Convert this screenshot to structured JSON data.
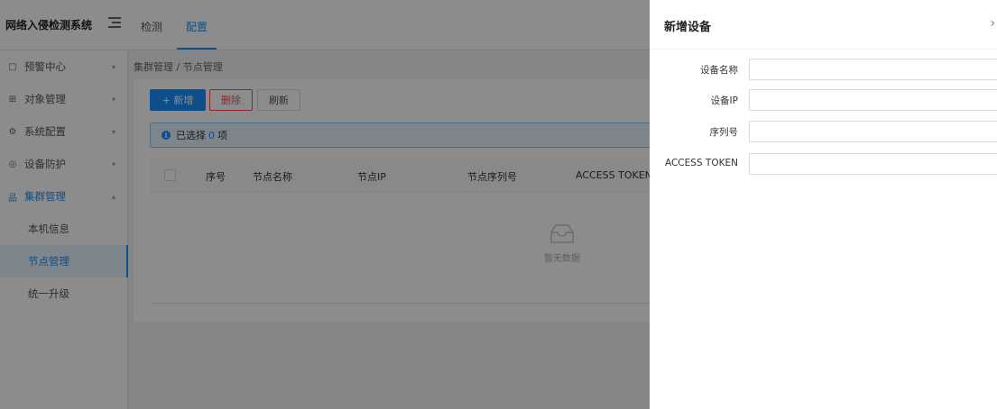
{
  "app": {
    "brand": "网络入侵检测系统",
    "top_tabs": [
      "检测",
      "配置"
    ]
  },
  "sidebar": {
    "items": [
      {
        "label": "预警中心",
        "icon": "bell-icon"
      },
      {
        "label": "对象管理",
        "icon": "grid-icon"
      },
      {
        "label": "系统配置",
        "icon": "gear-icon"
      },
      {
        "label": "设备防护",
        "icon": "shield-icon"
      },
      {
        "label": "集群管理",
        "icon": "cluster-icon"
      }
    ],
    "sub_items": [
      "本机信息",
      "节点管理",
      "统一升级"
    ]
  },
  "main": {
    "breadcrumb": "集群管理 / 节点管理",
    "buttons": {
      "add": "+ 新增",
      "delete": "删除",
      "refresh": "刷新"
    },
    "alert": {
      "prefix": "已选择",
      "count": "0",
      "suffix": "项"
    },
    "table_headers": [
      "序号",
      "节点名称",
      "节点IP",
      "节点序列号",
      "ACCESS TOKEN"
    ],
    "empty_text": "暂无数据"
  },
  "drawer": {
    "title": "新增设备",
    "fields": [
      {
        "label": "设备名称",
        "value": ""
      },
      {
        "label": "设备IP",
        "value": ""
      },
      {
        "label": "序列号",
        "value": ""
      },
      {
        "label": "ACCESS TOKEN",
        "value": ""
      }
    ]
  },
  "colors": {
    "accent": "#1890ff",
    "danger": "#ff4d4f"
  }
}
